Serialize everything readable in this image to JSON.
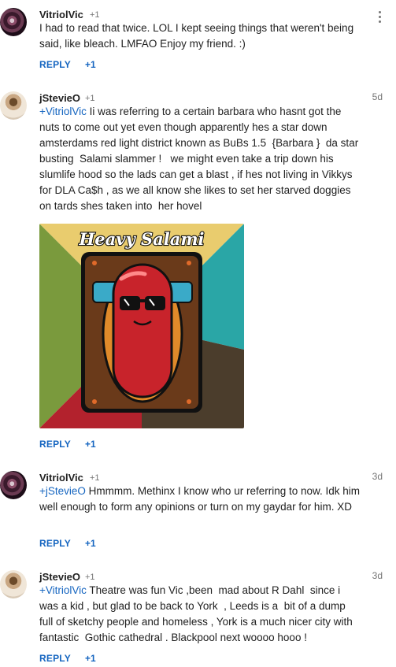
{
  "colors": {
    "link": "#1565c0",
    "text": "#212121",
    "muted": "#757575"
  },
  "comments": [
    {
      "author": "VitriolVic",
      "plus_count": "+1",
      "time": "",
      "text": "I had to read that twice. LOL I kept seeing things that weren't being said, like bleach. LMFAO Enjoy my friend. :)",
      "reply_label": "REPLY",
      "plus_one_label": "+1"
    },
    {
      "author": "jStevieO",
      "plus_count": "+1",
      "time": "5d",
      "mention": "+VitriolVic",
      "text": " Ii was referring to a certain barbara who hasnt got the nuts to come out yet even though apparently hes a star down amsterdams red light district known as BuBs 1.5  {Barbara }  da star busting  Salami slammer !   we might even take a trip down his slumlife hood so the lads can get a blast , if hes not living in Vikkys for DLA Ca$h , as we all know she likes to set her starved doggies on tards shes taken into  her hovel",
      "image": {
        "title": "Heavy Salami",
        "icon": "sausage-with-sunglasses-image"
      },
      "reply_label": "REPLY",
      "plus_one_label": "+1"
    },
    {
      "author": "VitriolVic",
      "plus_count": "+1",
      "time": "3d",
      "mention": "+jStevieO",
      "text": " Hmmmm. Methinx I know who ur referring to now. Idk him well enough to form any opinions or turn on my gaydar for him. XD",
      "reply_label": "REPLY",
      "plus_one_label": "+1"
    },
    {
      "author": "jStevieO",
      "plus_count": "+1",
      "time": "3d",
      "mention": "+VitriolVic",
      "text": " Theatre was fun Vic ,been  mad about R Dahl  since i was a kid , but glad to be back to York  , Leeds is a  bit of a dump full of sketchy people and homeless , York is a much nicer city with fantastic  Gothic cathedral . Blackpool next woooo hooo !",
      "reply_label": "REPLY",
      "plus_one_label": "+1"
    }
  ]
}
